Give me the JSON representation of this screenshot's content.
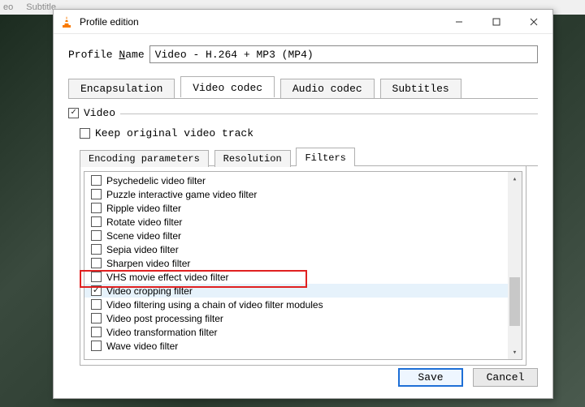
{
  "bg_menu": {
    "item1": "eo",
    "item2": "Subtitle"
  },
  "titlebar": {
    "title": "Profile edition"
  },
  "window_controls": {
    "minimize_tip": "Minimize",
    "maximize_tip": "Maximize",
    "close_tip": "Close"
  },
  "profile_name": {
    "label_pre": "Profile ",
    "label_underline": "N",
    "label_post": "ame",
    "value": "Video - H.264 + MP3 (MP4)"
  },
  "main_tabs": {
    "encapsulation": "Encapsulation",
    "video_codec": "Video codec",
    "audio_codec": "Audio codec",
    "subtitles": "Subtitles"
  },
  "video_section": {
    "video_checkbox_label": "Video",
    "keep_original_label": "Keep original video track"
  },
  "sub_tabs": {
    "encoding": "Encoding parameters",
    "resolution": "Resolution",
    "filters": "Filters"
  },
  "filters": [
    {
      "label": "Psychedelic video filter",
      "checked": false
    },
    {
      "label": "Puzzle interactive game video filter",
      "checked": false
    },
    {
      "label": "Ripple video filter",
      "checked": false
    },
    {
      "label": "Rotate video filter",
      "checked": false
    },
    {
      "label": "Scene video filter",
      "checked": false
    },
    {
      "label": "Sepia video filter",
      "checked": false
    },
    {
      "label": "Sharpen video filter",
      "checked": false
    },
    {
      "label": "VHS movie effect video filter",
      "checked": false
    },
    {
      "label": "Video cropping filter",
      "checked": true,
      "selected": true
    },
    {
      "label": "Video filtering using a chain of video filter modules",
      "checked": false
    },
    {
      "label": "Video post processing filter",
      "checked": false
    },
    {
      "label": "Video transformation filter",
      "checked": false
    },
    {
      "label": "Wave video filter",
      "checked": false
    }
  ],
  "buttons": {
    "save": "Save",
    "cancel": "Cancel"
  }
}
